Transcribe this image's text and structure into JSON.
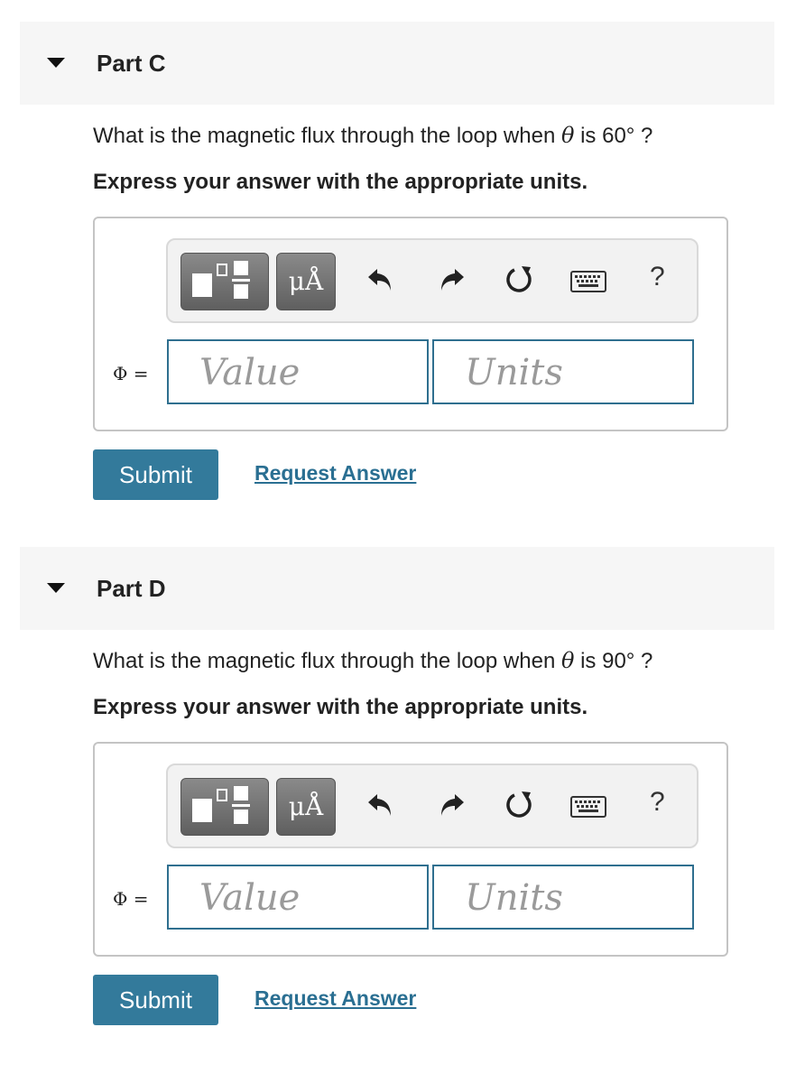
{
  "parts": [
    {
      "title": "Part C",
      "question_pre": "What is the magnetic flux through the loop when",
      "theta": "θ",
      "question_post": "is 60° ?",
      "instruction": "Express your answer with the appropriate units.",
      "toolbar": {
        "units_label": "μÅ",
        "help_label": "?"
      },
      "variable_label": "Φ =",
      "value_placeholder": "Value",
      "units_placeholder": "Units",
      "submit_label": "Submit",
      "request_label": "Request Answer"
    },
    {
      "title": "Part D",
      "question_pre": "What is the magnetic flux through the loop when",
      "theta": "θ",
      "question_post": "is 90° ?",
      "instruction": "Express your answer with the appropriate units.",
      "toolbar": {
        "units_label": "μÅ",
        "help_label": "?"
      },
      "variable_label": "Φ =",
      "value_placeholder": "Value",
      "units_placeholder": "Units",
      "submit_label": "Submit",
      "request_label": "Request Answer"
    }
  ],
  "icons": [
    "caret-down-icon",
    "templates-icon",
    "units-icon",
    "undo-icon",
    "redo-icon",
    "reset-icon",
    "keyboard-icon",
    "help-icon"
  ],
  "colors": {
    "accent": "#337a9b",
    "link": "#2a6f92",
    "field_border": "#2f6f8f",
    "header_bg": "#f6f6f6"
  }
}
